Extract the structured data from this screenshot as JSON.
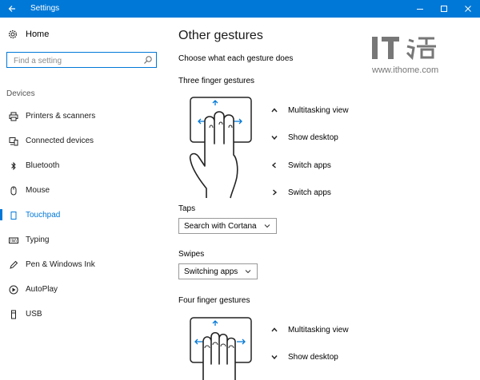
{
  "window": {
    "title": "Settings"
  },
  "sidebar": {
    "home_label": "Home",
    "search_placeholder": "Find a setting",
    "group_label": "Devices",
    "items": [
      {
        "label": "Printers & scanners",
        "icon": "printer-icon"
      },
      {
        "label": "Connected devices",
        "icon": "connected-devices-icon"
      },
      {
        "label": "Bluetooth",
        "icon": "bluetooth-icon"
      },
      {
        "label": "Mouse",
        "icon": "mouse-icon"
      },
      {
        "label": "Touchpad",
        "icon": "touchpad-icon",
        "selected": true
      },
      {
        "label": "Typing",
        "icon": "keyboard-icon"
      },
      {
        "label": "Pen & Windows Ink",
        "icon": "pen-icon"
      },
      {
        "label": "AutoPlay",
        "icon": "autoplay-icon"
      },
      {
        "label": "USB",
        "icon": "usb-icon"
      }
    ]
  },
  "main": {
    "title": "Other gestures",
    "subtitle": "Choose what each gesture does",
    "three_finger": {
      "heading": "Three finger gestures",
      "gestures": [
        {
          "direction": "up",
          "label": "Multitasking view"
        },
        {
          "direction": "down",
          "label": "Show desktop"
        },
        {
          "direction": "left",
          "label": "Switch apps"
        },
        {
          "direction": "right",
          "label": "Switch apps"
        }
      ],
      "taps_label": "Taps",
      "taps_value": "Search with Cortana",
      "swipes_label": "Swipes",
      "swipes_value": "Switching apps"
    },
    "four_finger": {
      "heading": "Four finger gestures",
      "gestures": [
        {
          "direction": "up",
          "label": "Multitasking view"
        },
        {
          "direction": "down",
          "label": "Show desktop"
        }
      ]
    }
  },
  "watermark": {
    "url": "www.ithome.com"
  },
  "colors": {
    "accent": "#0078d7",
    "text": "#1a1a1a",
    "muted": "#555555"
  }
}
